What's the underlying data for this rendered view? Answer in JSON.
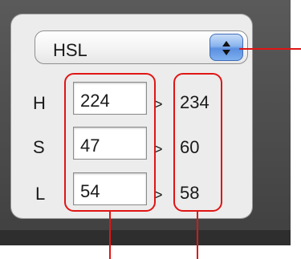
{
  "color_mode": {
    "selected": "HSL"
  },
  "rows": [
    {
      "label": "H",
      "value": "224",
      "separator": ">",
      "converted": "234"
    },
    {
      "label": "S",
      "value": "47",
      "separator": ">",
      "converted": "60"
    },
    {
      "label": "L",
      "value": "54",
      "separator": ">",
      "converted": "58"
    }
  ],
  "colors": {
    "annotation": "#e01515",
    "stepper_accent": "#5b8fe0",
    "panel_background": "#ececec",
    "frame_background": "#4a4a4a"
  },
  "icons": {
    "stepper": "up-down-stepper-icon"
  }
}
